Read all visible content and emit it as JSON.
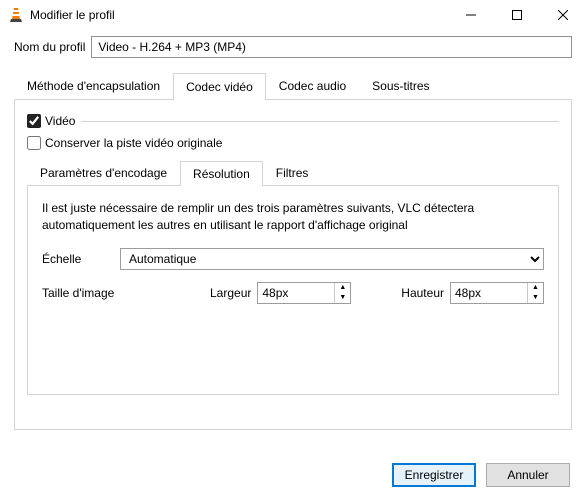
{
  "window": {
    "title": "Modifier le profil"
  },
  "profile": {
    "name_label": "Nom du profil",
    "name_value": "Video - H.264 + MP3 (MP4)"
  },
  "tabs_main": {
    "encapsulation": "Méthode d'encapsulation",
    "video_codec": "Codec vidéo",
    "audio_codec": "Codec audio",
    "subtitles": "Sous-titres",
    "active": "video_codec"
  },
  "video": {
    "checkbox_label": "Vidéo",
    "checked": true,
    "keep_original_label": "Conserver la piste vidéo originale",
    "keep_original_checked": false
  },
  "tabs_sub": {
    "encoding": "Paramètres d'encodage",
    "resolution": "Résolution",
    "filters": "Filtres",
    "active": "resolution"
  },
  "resolution": {
    "description": "Il est juste nécessaire de remplir un des trois paramètres suivants, VLC détectera automatiquement les autres en utilisant le rapport d'affichage original",
    "scale_label": "Échelle",
    "scale_value": "Automatique",
    "framesize_label": "Taille d'image",
    "width_label": "Largeur",
    "width_value": "48px",
    "height_label": "Hauteur",
    "height_value": "48px"
  },
  "buttons": {
    "save": "Enregistrer",
    "cancel": "Annuler"
  }
}
